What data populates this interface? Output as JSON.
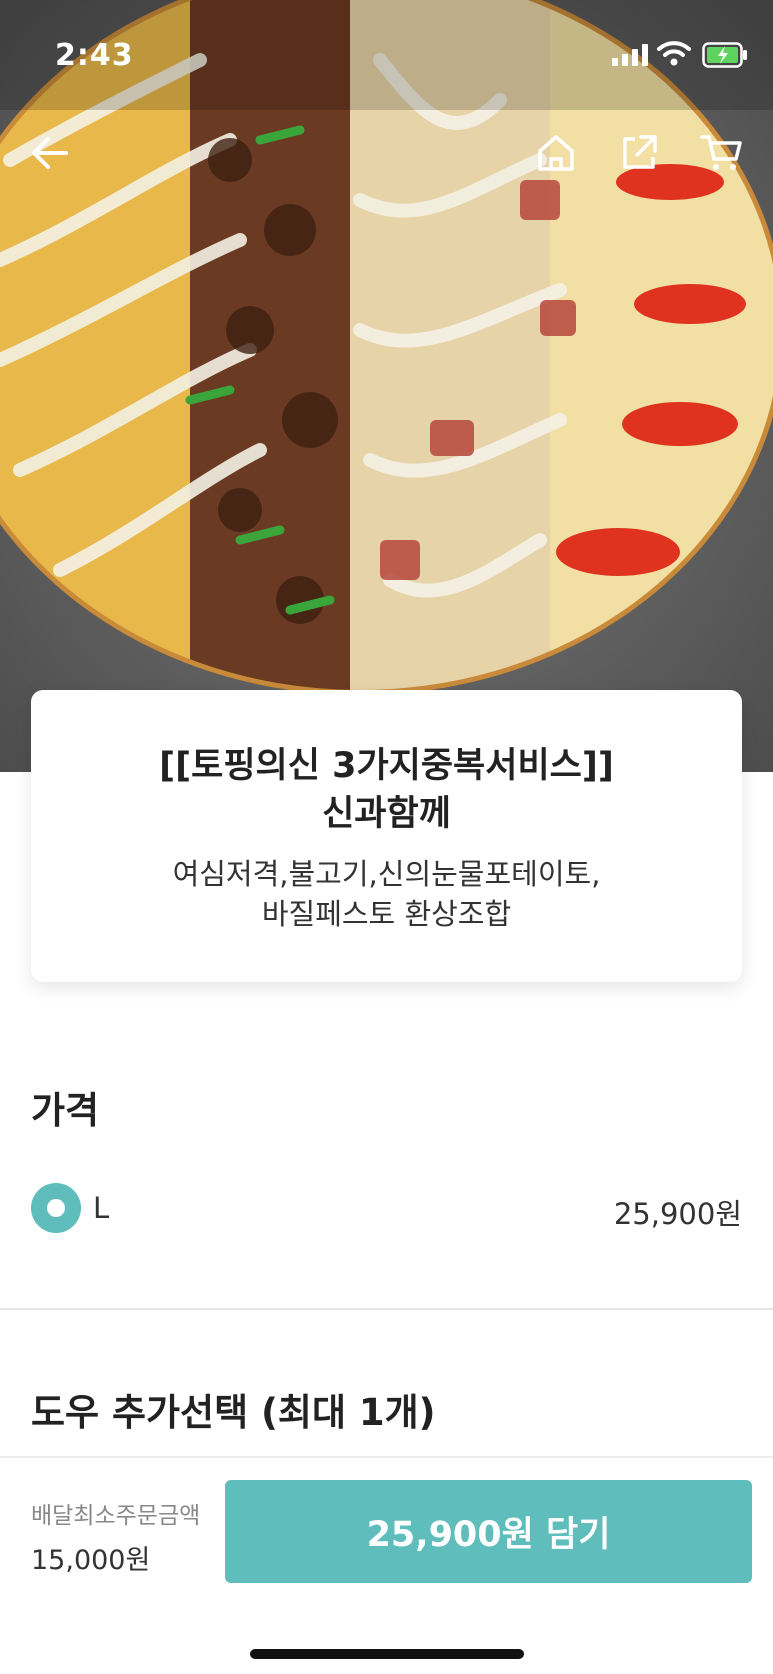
{
  "status_bar": {
    "time": "2:43"
  },
  "nav": {
    "back_icon": "arrow-left-icon",
    "home_icon": "home-icon",
    "share_icon": "share-icon",
    "cart_icon": "cart-icon"
  },
  "product": {
    "title_line1": "[[토핑의신 3가지중복서비스]]",
    "title_line2": "신과함께",
    "desc_line1": "여심저격,불고기,신의눈물포테이토,",
    "desc_line2": "바질페스토 환상조합"
  },
  "price_section": {
    "title": "가격",
    "options": [
      {
        "label": "L",
        "price": "25,900원",
        "selected": true
      }
    ]
  },
  "dough_section": {
    "title": "도우 추가선택 (최대 1개)"
  },
  "bottom_bar": {
    "min_order_label": "배달최소주문금액",
    "min_order_value": "15,000원",
    "order_button": "25,900원 담기"
  },
  "colors": {
    "accent": "#5fbdbb"
  }
}
